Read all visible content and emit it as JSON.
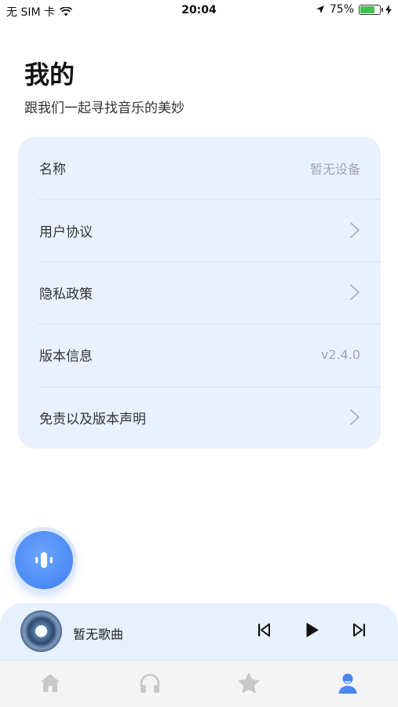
{
  "status_bar": {
    "carrier": "无 SIM 卡",
    "time": "20:04",
    "battery_percent": "75%",
    "battery_level": 0.75,
    "icons": [
      "wifi-icon",
      "location-arrow-icon",
      "battery-icon",
      "charging-bolt-icon"
    ]
  },
  "header": {
    "title": "我的",
    "subtitle": "跟我们一起寻找音乐的美妙"
  },
  "settings": {
    "rows": [
      {
        "label": "名称",
        "value": "暂无设备",
        "chevron": false
      },
      {
        "label": "用户协议",
        "value": "",
        "chevron": true
      },
      {
        "label": "隐私政策",
        "value": "",
        "chevron": true
      },
      {
        "label": "版本信息",
        "value": "v2.4.0",
        "chevron": false
      },
      {
        "label": "免责以及版本声明",
        "value": "",
        "chevron": true
      }
    ]
  },
  "player": {
    "song_title": "暂无歌曲",
    "controls": [
      "previous-icon",
      "play-icon",
      "next-icon"
    ]
  },
  "tabbar": {
    "tabs": [
      {
        "icon": "home-icon",
        "active": false
      },
      {
        "icon": "headphones-icon",
        "active": false
      },
      {
        "icon": "star-icon",
        "active": false
      },
      {
        "icon": "user-icon",
        "active": true
      }
    ]
  },
  "colors": {
    "accent": "#4a86f0",
    "card_bg": "#e9f1ff",
    "player_bg": "#e6f1fd",
    "tab_inactive": "#c8c8c8"
  }
}
